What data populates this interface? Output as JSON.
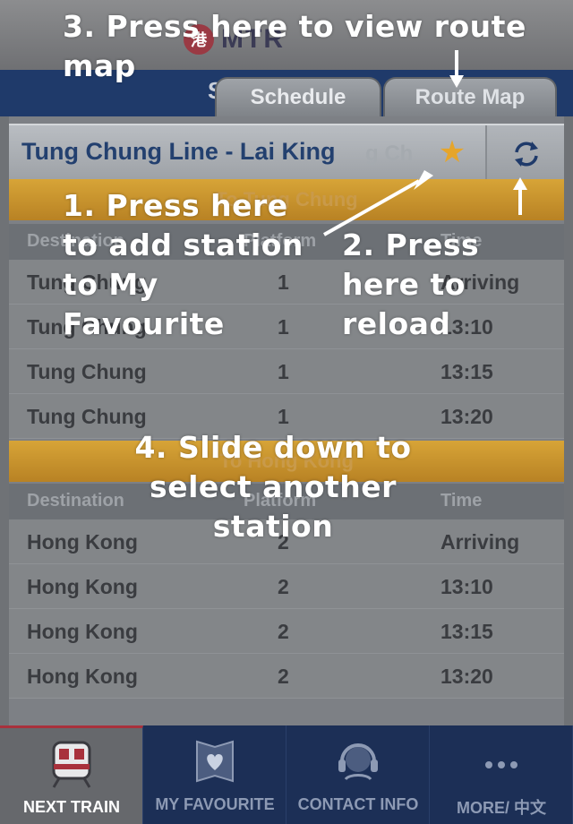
{
  "header": {
    "logo_mark": "港",
    "logo_word": "MTR",
    "strip_ghost": "S"
  },
  "tabs": {
    "schedule": "Schedule",
    "route_map": "Route Map"
  },
  "station_bar": {
    "name": "Tung Chung Line - Lai King",
    "ghost": "g Ch"
  },
  "section1": {
    "title": "To Tung Chung",
    "headers": [
      "Destination",
      "Platform",
      "Time"
    ],
    "rows": [
      [
        "Tung Chung",
        "1",
        "Arriving"
      ],
      [
        "Tung Chung",
        "1",
        "13:10"
      ],
      [
        "Tung Chung",
        "1",
        "13:15"
      ],
      [
        "Tung Chung",
        "1",
        "13:20"
      ]
    ]
  },
  "section2": {
    "title": "To Hong Kong",
    "headers": [
      "Destination",
      "Platform",
      "Time"
    ],
    "rows": [
      [
        "Hong Kong",
        "2",
        "Arriving"
      ],
      [
        "Hong Kong",
        "2",
        "13:10"
      ],
      [
        "Hong Kong",
        "2",
        "13:15"
      ],
      [
        "Hong Kong",
        "2",
        "13:20"
      ]
    ]
  },
  "tabbar": {
    "items": [
      {
        "label": "NEXT TRAIN",
        "icon": "train-icon",
        "active": true
      },
      {
        "label": "MY FAVOURITE",
        "icon": "heart-book-icon",
        "active": false
      },
      {
        "label": "CONTACT INFO",
        "icon": "headset-icon",
        "active": false
      },
      {
        "label": "MORE/ 中文",
        "icon": "more-dots-icon",
        "active": false
      }
    ]
  },
  "annotations": {
    "step3": "3. Press here to view route map",
    "step1": "1. Press here to add station to My Favourite",
    "step2": "2. Press here to reload",
    "step4": "4. Slide down to select another station"
  },
  "colors": {
    "header_blue": "#1f3a6a",
    "section_orange": "#c8932c",
    "tabbar_navy": "#1c2f56",
    "accent_red": "#a8313c",
    "station_text": "#23406f",
    "star": "#e6a52a"
  }
}
